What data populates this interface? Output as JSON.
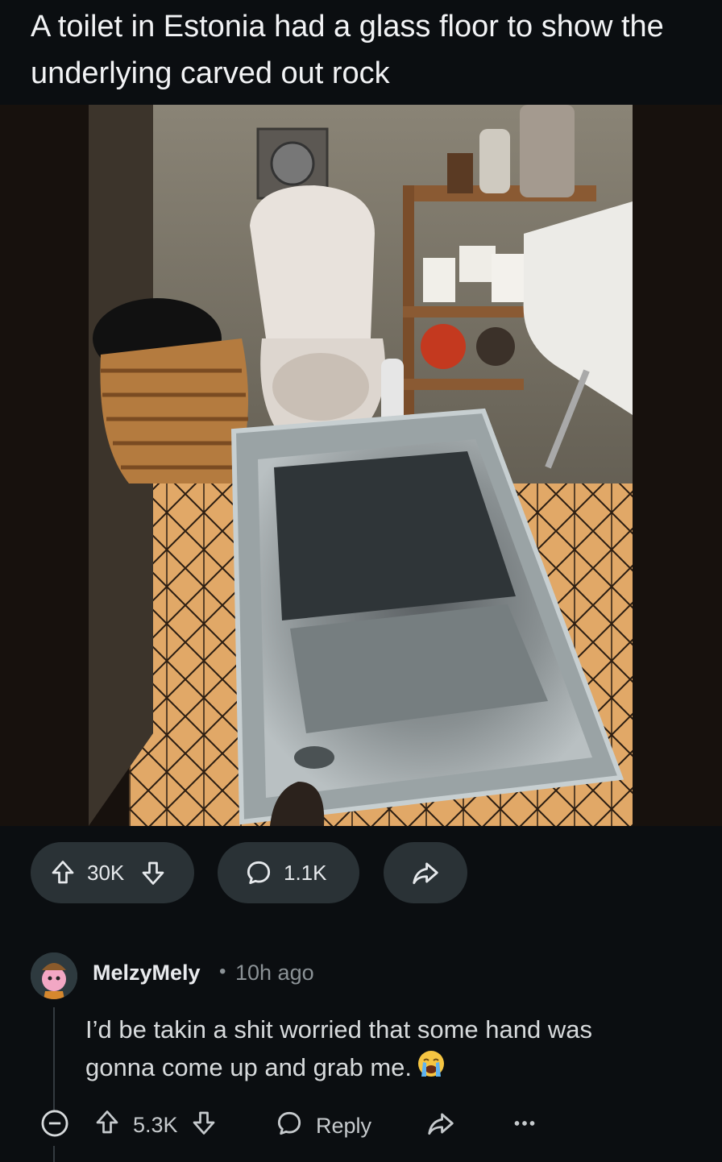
{
  "post": {
    "title": "A toilet in Estonia had a glass floor to show the underlying carved out rock"
  },
  "actions": {
    "upvotes": "30K",
    "comments": "1.1K"
  },
  "comment": {
    "username": "MelzyMely",
    "separator": "•",
    "time": "10h ago",
    "text": "I’d be takin a shit worried that some hand was gonna come up and grab me.",
    "emoji": "loudly-crying-face",
    "upvotes": "5.3K",
    "reply_label": "Reply"
  },
  "colors": {
    "background": "#0b0e11",
    "pill": "#2a3236",
    "text": "#d7dadc",
    "muted": "#8b9296"
  }
}
